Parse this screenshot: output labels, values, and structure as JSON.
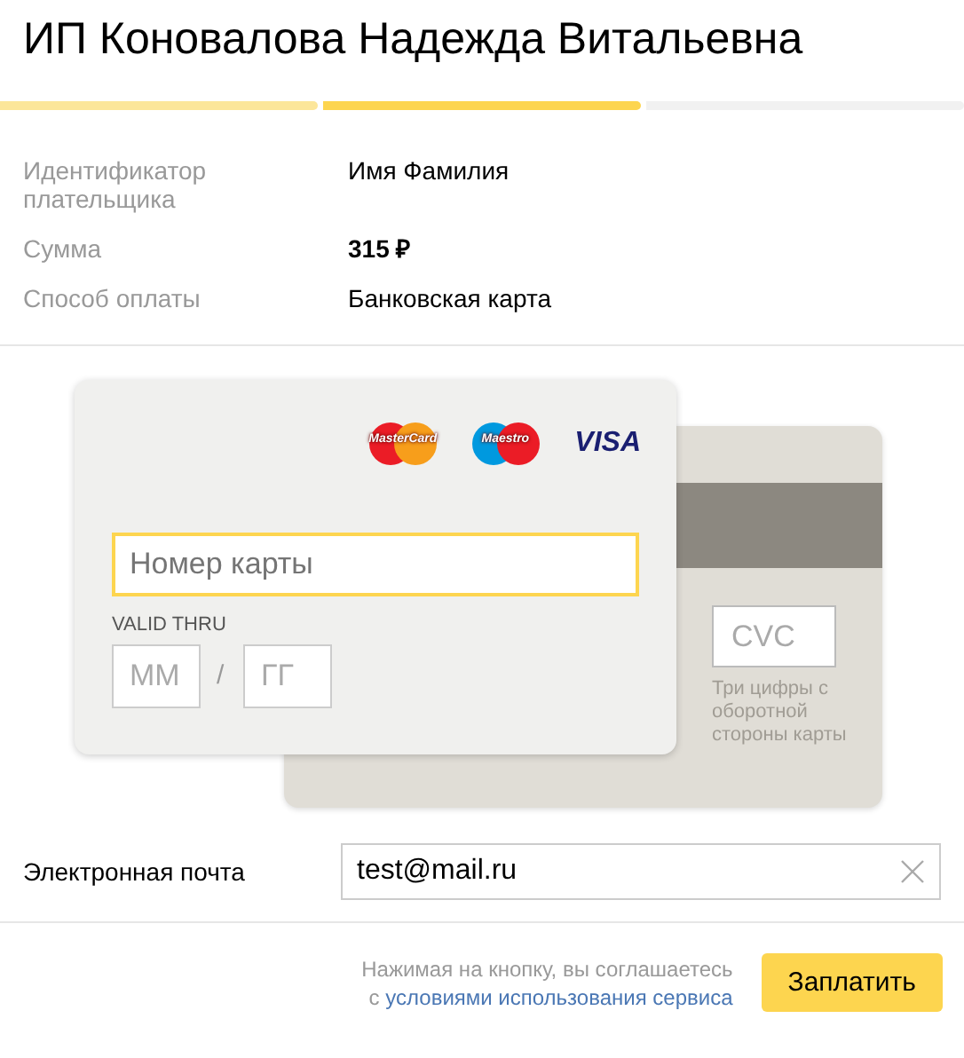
{
  "title": "ИП Коновалова Надежда Витальевна",
  "progress_steps": [
    {
      "completed": true,
      "selected": false
    },
    {
      "completed": false,
      "selected": true
    },
    {
      "completed": false,
      "selected": false
    }
  ],
  "details": [
    {
      "label": "Идентификатор плательщика",
      "value": "Имя Фамилия",
      "bold": false
    },
    {
      "label": "Сумма",
      "value": "315 ₽",
      "bold": true
    },
    {
      "label": "Способ оплаты",
      "value": "Банковская карта",
      "bold": false
    }
  ],
  "card": {
    "brands": [
      {
        "kind": "mastercard",
        "text": "MasterCard"
      },
      {
        "kind": "maestro",
        "text": "Maestro"
      },
      {
        "kind": "visa",
        "text": "VISA"
      }
    ],
    "number": {
      "placeholder": "Номер карты",
      "focused": true
    },
    "valid_thru_label": "VALID THRU",
    "month": {
      "placeholder": "ММ"
    },
    "separator": "/",
    "year": {
      "placeholder": "ГГ"
    },
    "cvc": {
      "placeholder": "CVC"
    },
    "cvc_hint": "Три цифры с оборотной стороны карты"
  },
  "email": {
    "label": "Электронная почта",
    "value": "test@mail.ru"
  },
  "agreement": {
    "text": "Нажимая на кнопку, вы соглашаетесь с",
    "link": "условиями использования сервиса"
  },
  "pay_button": "Заплатить"
}
